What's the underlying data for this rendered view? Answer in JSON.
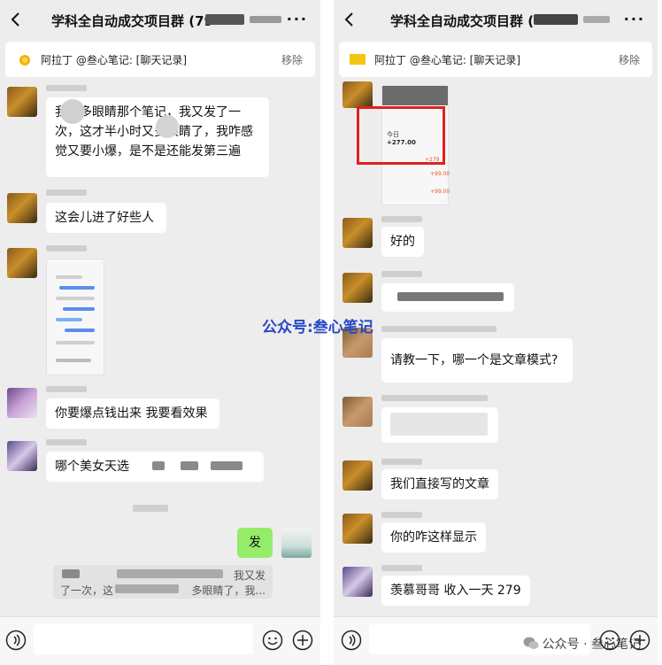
{
  "left": {
    "header": {
      "title": "学科全自动成交项目群 (79"
    },
    "pinned": {
      "text": "阿拉丁 @叁心笔记: [聊天记录]",
      "action": "移除"
    },
    "messages": [
      {
        "text": "我千多眼睛那个笔记，我又发了一次，这才半小时又多眼睛了，我咋感觉又要小爆，是不是还能发第三遍"
      },
      {
        "text": "这会儿进了好些人"
      },
      {
        "text": "你要爆点钱出来 我要看效果"
      },
      {
        "text": "哪个美女天选"
      },
      {
        "text": "发"
      }
    ],
    "quote": {
      "line1": "我又发",
      "line2": "了一次，这",
      "line3": "多眼睛了，我..."
    }
  },
  "right": {
    "header": {
      "title": "学科全自动成交项目群 ("
    },
    "pinned": {
      "text": "阿拉丁 @叁心笔记: [聊天记录]",
      "action": "移除"
    },
    "shot": {
      "label": "今日",
      "amount": "+277.00",
      "side": "+279",
      "r1": "+99.00",
      "r2": "+99.00"
    },
    "messages": [
      {
        "text": "好的"
      },
      {
        "text": "请教一下，哪一个是文章模式?"
      },
      {
        "text": "我们直接写的文章"
      },
      {
        "text": "你的咋这样显示"
      },
      {
        "text": "羡慕哥哥 收入一天 279"
      }
    ]
  },
  "watermark": "公众号:叁心笔记",
  "footer_mark": "公众号 · 叁心笔记",
  "colors": {
    "panel_bg": "#ededed",
    "sent_bubble": "#95ec69",
    "highlight": "#e02020",
    "watermark": "#2a47c8"
  }
}
